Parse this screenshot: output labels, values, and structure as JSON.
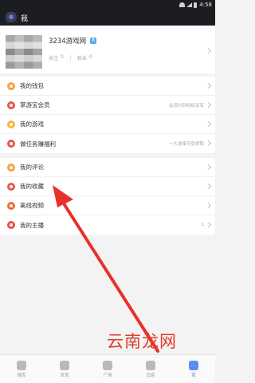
{
  "status_bar": {
    "time": "4:58"
  },
  "header": {
    "title": "我"
  },
  "profile": {
    "name": "3234游戏网",
    "badge": "8",
    "follow_label": "关注",
    "follow_count": "0",
    "fans_label": "粉丝",
    "fans_count": "0"
  },
  "menu_groups": [
    {
      "items": [
        {
          "label": "我的钱包",
          "icon": "wallet-icon",
          "color": "#f2a33a",
          "right": ""
        },
        {
          "label": "掌游宝会员",
          "icon": "vip-icon",
          "color": "#e4574c",
          "right": "会员时刻特权享有"
        },
        {
          "label": "我的游戏",
          "icon": "game-icon",
          "color": "#f4b63b",
          "right": ""
        },
        {
          "label": "做任务赚福利",
          "icon": "task-icon",
          "color": "#e25a4f",
          "right": "一大波事节免领取"
        }
      ]
    },
    {
      "items": [
        {
          "label": "我的评论",
          "icon": "comment-icon",
          "color": "#f2a33a",
          "right": ""
        },
        {
          "label": "我的收藏",
          "icon": "star-icon",
          "color": "#e7574d",
          "right": ""
        },
        {
          "label": "离线视频",
          "icon": "video-icon",
          "color": "#ee6a3a",
          "right": ""
        },
        {
          "label": "我的主播",
          "icon": "streamer-icon",
          "color": "#ea4f48",
          "right": "1"
        }
      ]
    }
  ],
  "bottom_nav": [
    {
      "label": "搜库",
      "icon": "controller-icon",
      "active": false
    },
    {
      "label": "发现",
      "icon": "compass-icon",
      "active": false
    },
    {
      "label": "广场",
      "icon": "plaza-icon",
      "active": false
    },
    {
      "label": "消息",
      "icon": "message-icon",
      "active": false
    },
    {
      "label": "我",
      "icon": "user-icon",
      "active": true
    }
  ],
  "watermark": "云南龙网",
  "colors": {
    "header_bg": "#1c1d21",
    "accent": "#5b8ff5",
    "arrow": "#e8312a"
  }
}
